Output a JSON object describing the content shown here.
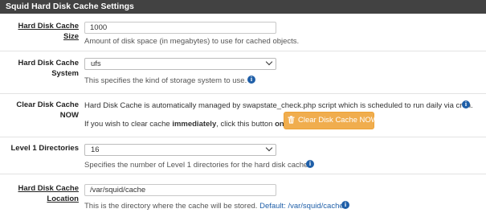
{
  "panel": {
    "title": "Squid Hard Disk Cache Settings"
  },
  "size": {
    "label_line1": "Hard Disk Cache",
    "label_line2": "Size",
    "value": "1000",
    "help": "Amount of disk space (in megabytes) to use for cached objects."
  },
  "system": {
    "label_line1": "Hard Disk Cache",
    "label_line2": "System",
    "selected": "ufs",
    "help": "This specifies the kind of storage system to use."
  },
  "clear": {
    "label_line1": "Clear Disk Cache",
    "label_line2": "NOW",
    "desc": "Hard Disk Cache is automatically managed by swapstate_check.php script which is scheduled to run daily via cron.",
    "prompt_pre": "If you wish to clear cache ",
    "prompt_bold1": "immediately",
    "prompt_mid": ", click this button ",
    "prompt_bold2": "once",
    "prompt_post": ":",
    "button_label": "Clear Disk Cache NOW"
  },
  "level1": {
    "label": "Level 1 Directories",
    "selected": "16",
    "help": "Specifies the number of Level 1 directories for the hard disk cache."
  },
  "location": {
    "label_line1": "Hard Disk Cache",
    "label_line2": "Location",
    "value": "/var/squid/cache",
    "help": "This is the directory where the cache will be stored.",
    "default_text": "Default: /var/squid/cache"
  },
  "icons": {
    "info": "info-icon",
    "trash": "trash-icon",
    "dropdown": "chevron-down-icon"
  },
  "colors": {
    "header_bg": "#424242",
    "warning_button": "#f0ad4e",
    "info_icon": "#1f5fa8"
  }
}
